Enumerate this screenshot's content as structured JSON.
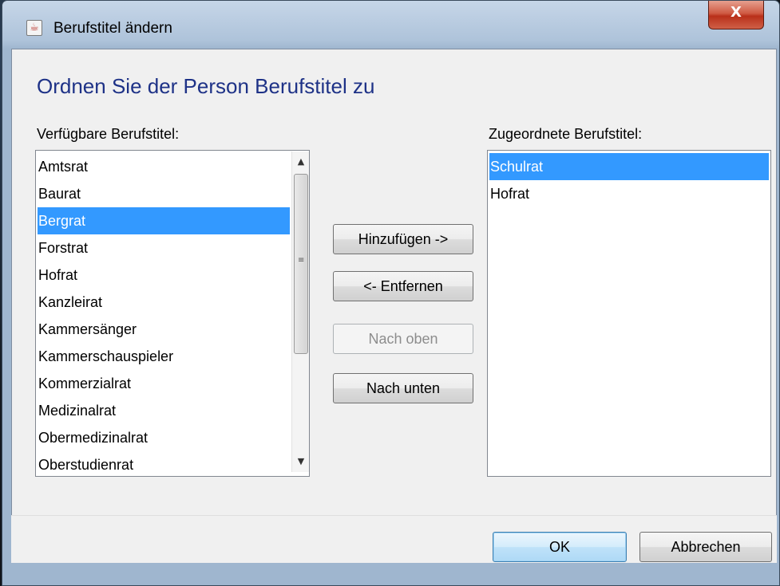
{
  "window": {
    "title": "Berufstitel ändern",
    "icon": "java-cup-icon",
    "close_label": "X"
  },
  "dialog": {
    "heading": "Ordnen Sie der Person Berufstitel zu",
    "available": {
      "label": "Verfügbare Berufstitel:",
      "items": [
        "Amtsrat",
        "Baurat",
        "Bergrat",
        "Forstrat",
        "Hofrat",
        "Kanzleirat",
        "Kammersänger",
        "Kammerschauspieler",
        "Kommerzialrat",
        "Medizinalrat",
        "Obermedizinalrat",
        "Oberstudienrat"
      ],
      "selected": "Bergrat"
    },
    "assigned": {
      "label": "Zugeordnete Berufstitel:",
      "items": [
        "Schulrat",
        "Hofrat"
      ],
      "selected": "Schulrat"
    },
    "buttons": {
      "add": "Hinzufügen ->",
      "remove": "<- Entfernen",
      "up": "Nach oben",
      "down": "Nach unten"
    },
    "footer": {
      "ok": "OK",
      "cancel": "Abbrechen"
    }
  },
  "colors": {
    "selection": "#3399ff",
    "heading": "#1e3287"
  }
}
